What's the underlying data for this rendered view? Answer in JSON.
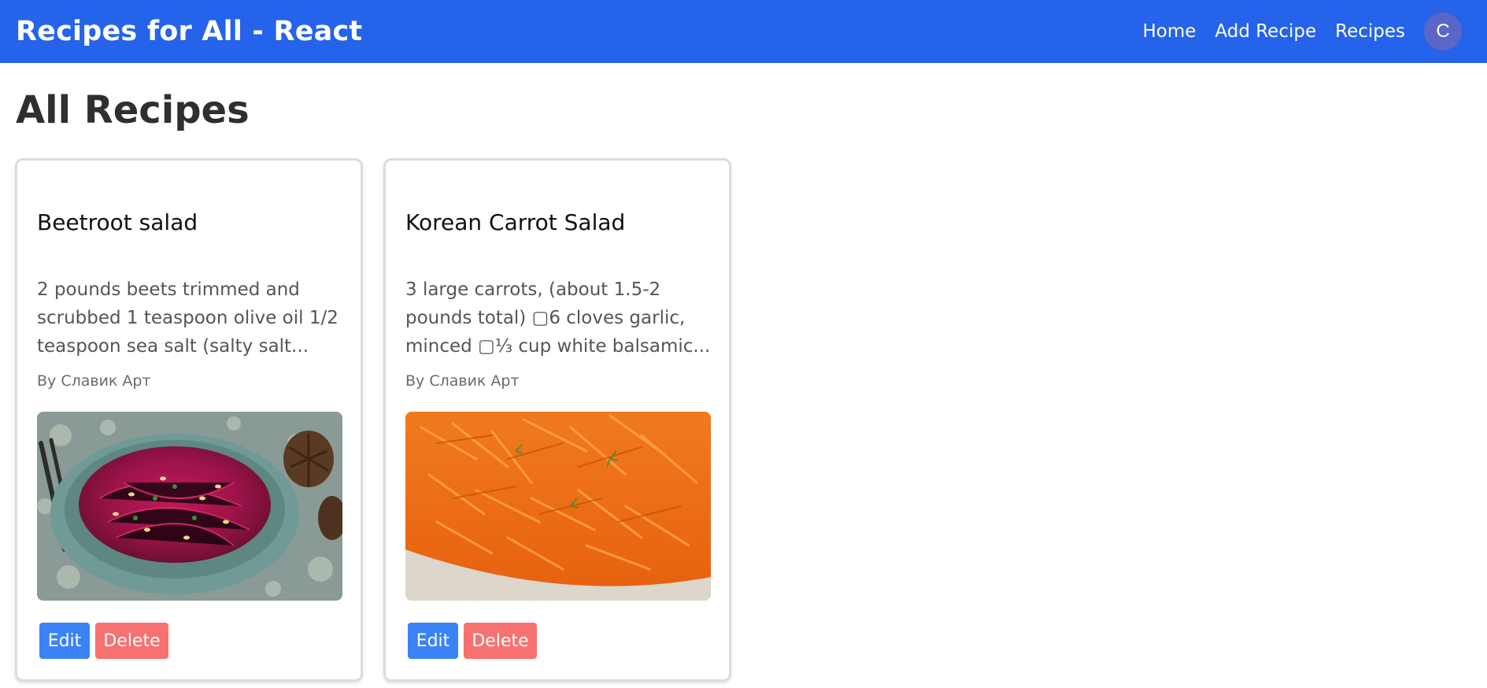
{
  "header": {
    "brand": "Recipes for All - React",
    "nav": [
      "Home",
      "Add Recipe",
      "Recipes"
    ],
    "avatar_initial": "C"
  },
  "main": {
    "title": "All Recipes",
    "recipes": [
      {
        "title": "Beetroot salad",
        "description": "2 pounds beets trimmed and scrubbed 1 teaspoon olive oil 1/2 teaspoon sea salt (salty salt...",
        "author": "By Славик Арт",
        "image": "beetroot-salad-photo",
        "edit_label": "Edit",
        "delete_label": "Delete"
      },
      {
        "title": "Korean Carrot Salad",
        "description": "3 large carrots, (about 1.5-2 pounds total) ▢6 cloves garlic, minced ▢⅓ cup white balsamic...",
        "author": "By Славик Арт",
        "image": "carrot-salad-photo",
        "edit_label": "Edit",
        "delete_label": "Delete"
      }
    ]
  },
  "colors": {
    "navbar": "#2563eb",
    "edit_button": "#3b82f6",
    "delete_button": "#f87171",
    "avatar": "#5a67c8"
  }
}
